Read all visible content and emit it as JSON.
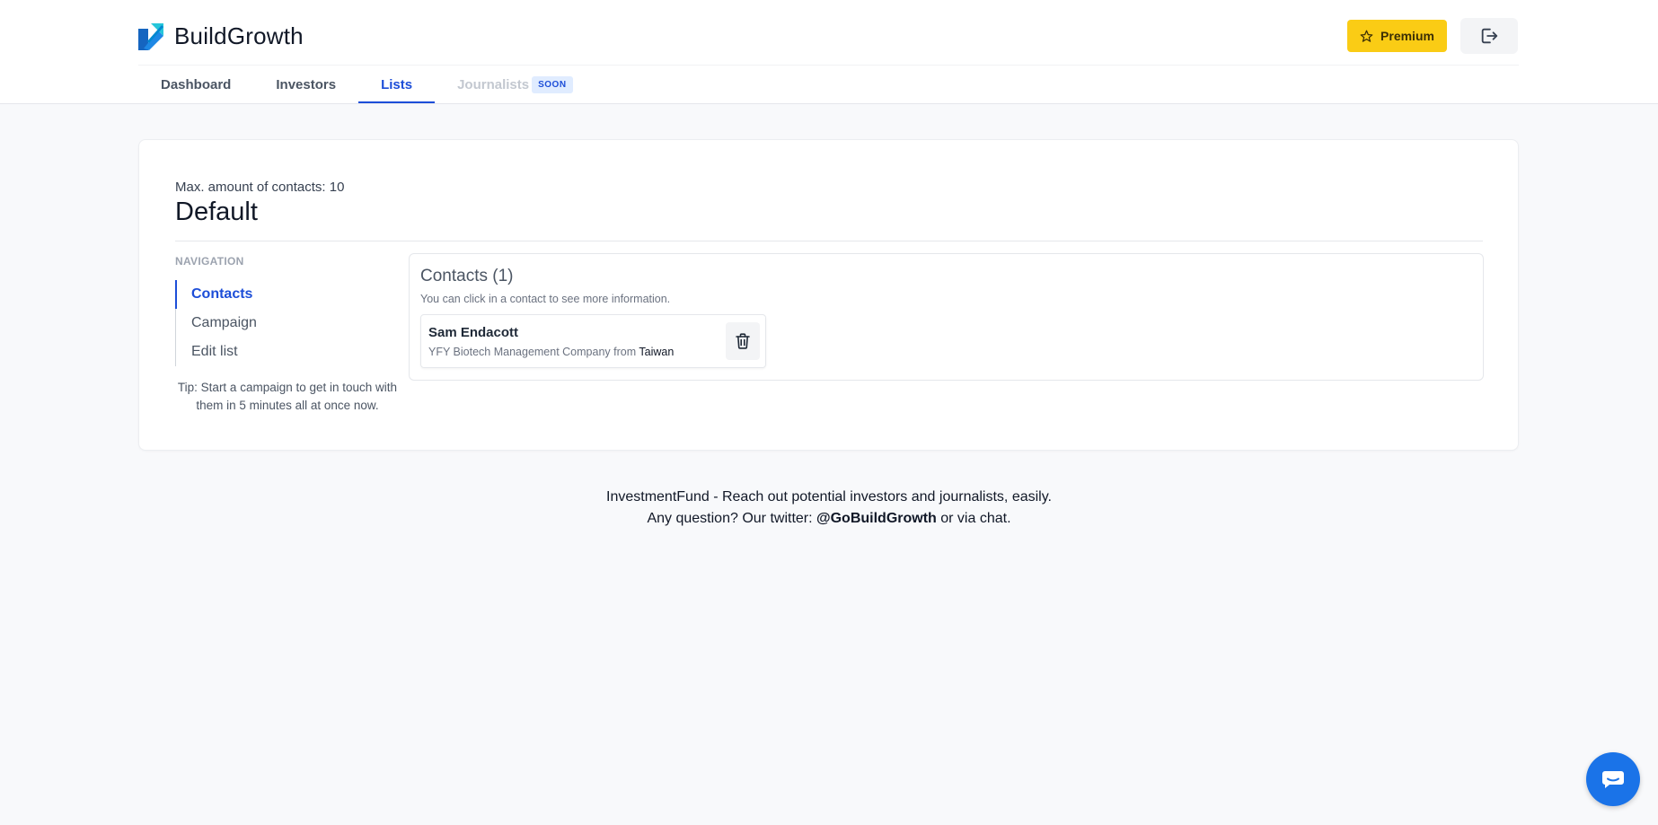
{
  "brand": {
    "name": "BuildGrowth"
  },
  "header": {
    "premium_label": "Premium",
    "logout_icon": "logout-icon"
  },
  "tabs": [
    {
      "label": "Dashboard",
      "active": false
    },
    {
      "label": "Investors",
      "active": false
    },
    {
      "label": "Lists",
      "active": true
    },
    {
      "label": "Journalists",
      "active": false,
      "disabled": true,
      "badge": "SOON"
    }
  ],
  "list": {
    "max_contacts": "Max. amount of contacts: 10",
    "title": "Default"
  },
  "navigation": {
    "heading": "NAVIGATION",
    "items": [
      {
        "label": "Contacts",
        "active": true
      },
      {
        "label": "Campaign",
        "active": false
      },
      {
        "label": "Edit list",
        "active": false
      }
    ],
    "tip": "Tip: Start a campaign to get in touch with them in 5 minutes all at once now."
  },
  "contacts": {
    "title": "Contacts (1)",
    "hint": "You can click in a contact to see more information.",
    "items": [
      {
        "name": "Sam Endacott",
        "company": "YFY Biotech Management Company from ",
        "country": "Taiwan"
      }
    ]
  },
  "footer": {
    "line1": "InvestmentFund - Reach out potential investors and journalists, easily.",
    "line2_prefix": "Any question? Our twitter: ",
    "twitter": "@GoBuildGrowth",
    "line2_suffix": " or via chat."
  },
  "colors": {
    "accent": "#1d4ed8",
    "premium": "#facc15",
    "chat": "#1a73e8"
  }
}
